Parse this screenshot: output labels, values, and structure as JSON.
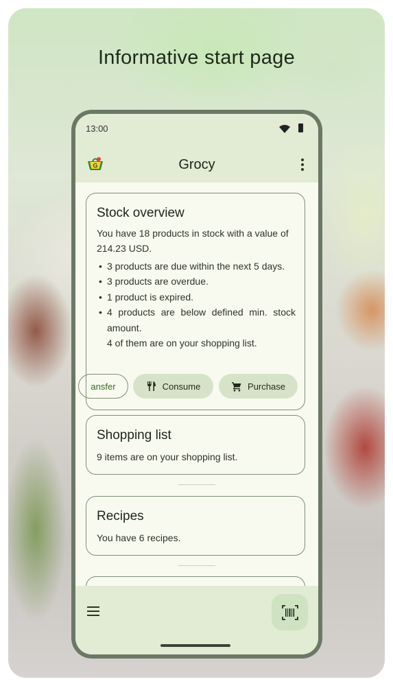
{
  "headline": "Informative start page",
  "status_bar": {
    "time": "13:00"
  },
  "app_bar": {
    "title": "Grocy",
    "logo_icon": "grocy-basket-logo-icon",
    "menu_icon": "more-vert-icon"
  },
  "stock_overview": {
    "title": "Stock overview",
    "summary": "You have 18 products in stock with a value of 214.23 USD.",
    "bullets": [
      "3 products are due within the next 5 days.",
      "3 products are overdue.",
      "1 product is expired.",
      "4 products are below defined min. stock amount."
    ],
    "note": "4 of them are on your shopping list.",
    "actions": [
      {
        "label": "Transfer",
        "visible_label": "ansfer",
        "icon": "transfer-icon"
      },
      {
        "label": "Consume",
        "icon": "restaurant-icon"
      },
      {
        "label": "Purchase",
        "icon": "shopping-cart-icon"
      }
    ]
  },
  "shopping_list": {
    "title": "Shopping list",
    "text": "9 items are on your shopping list."
  },
  "recipes": {
    "title": "Recipes",
    "text": "You have 6 recipes."
  },
  "bottom_bar": {
    "menu_icon": "hamburger-menu-icon",
    "fab_icon": "barcode-scan-icon"
  },
  "colors": {
    "accent": "#d6e3c8",
    "bar": "#e2ebd4",
    "surface": "#f8faf0",
    "outline": "#7d8e74",
    "text": "#1c2519"
  }
}
